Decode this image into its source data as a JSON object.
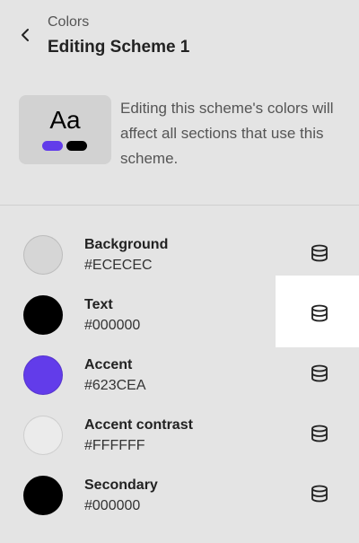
{
  "header": {
    "back_icon": "chevron-left-icon",
    "subtitle": "Colors",
    "title": "Editing Scheme 1"
  },
  "preview": {
    "sample_text": "Aa",
    "accent_color": "#623CEA",
    "secondary_color": "#000000"
  },
  "description": "Editing this scheme's colors will affect all sections that use this scheme.",
  "colors": [
    {
      "name": "Background",
      "value": "#ECECEC",
      "swatch": "#D6D6D6",
      "icon": "database-icon"
    },
    {
      "name": "Text",
      "value": "#000000",
      "swatch": "#000000",
      "icon": "database-icon"
    },
    {
      "name": "Accent",
      "value": "#623CEA",
      "swatch": "#623CEA",
      "icon": "database-icon"
    },
    {
      "name": "Accent contrast",
      "value": "#FFFFFF",
      "swatch": "#EBEBEB",
      "icon": "database-icon"
    },
    {
      "name": "Secondary",
      "value": "#000000",
      "swatch": "#000000",
      "icon": "database-icon"
    }
  ]
}
